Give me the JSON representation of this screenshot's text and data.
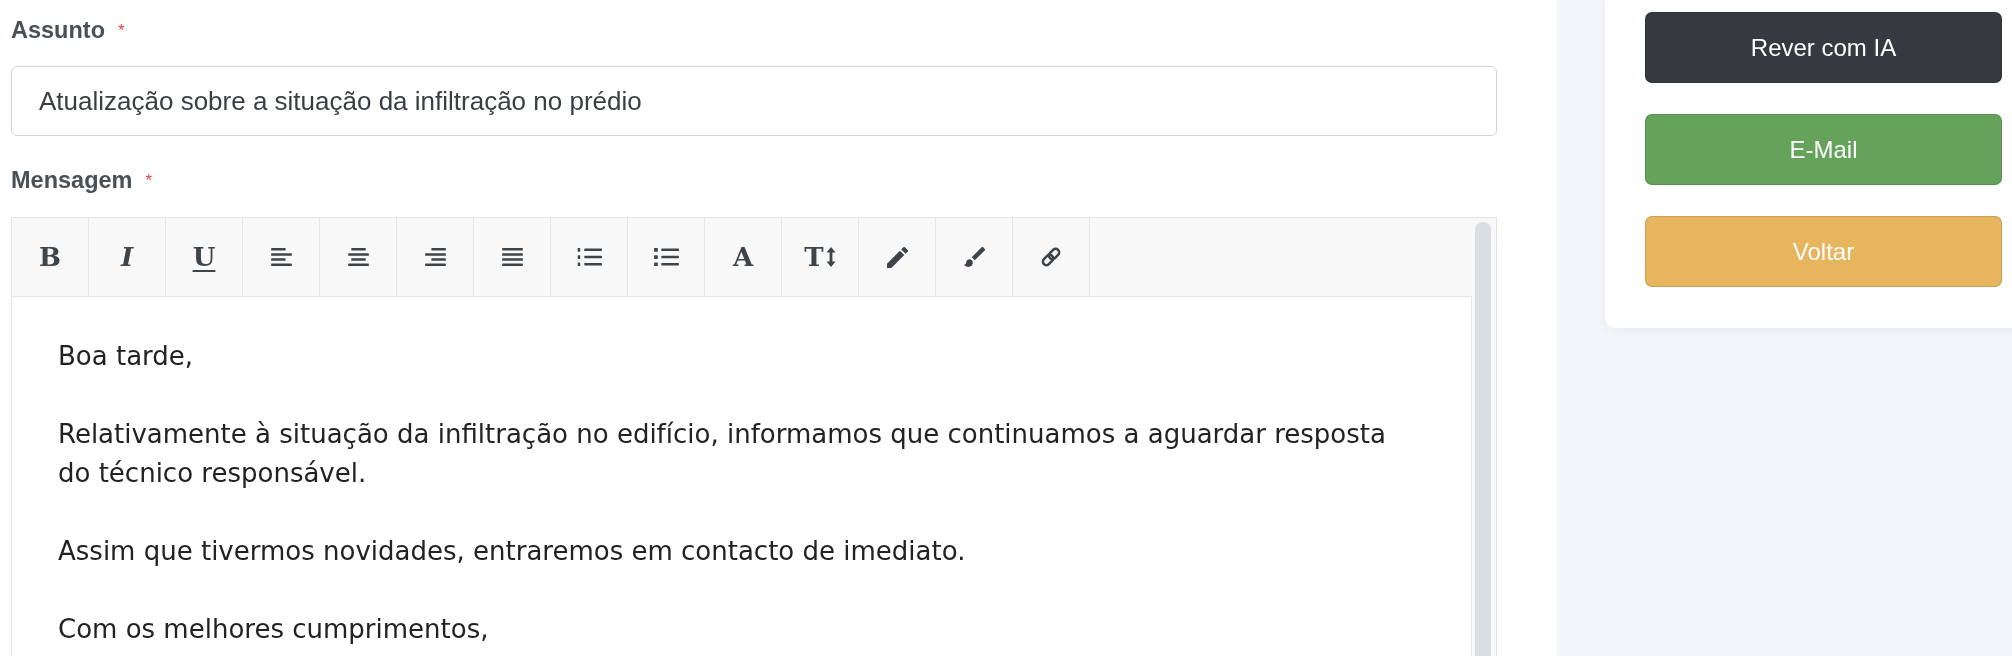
{
  "subject": {
    "label": "Assunto",
    "required_mark": "*",
    "value": "Atualização sobre a situação da infiltração no prédio"
  },
  "message": {
    "label": "Mensagem",
    "required_mark": "*",
    "toolbar": [
      {
        "kind": "bold",
        "glyph": "B"
      },
      {
        "kind": "italic",
        "glyph": "I"
      },
      {
        "kind": "underline",
        "glyph": "U"
      },
      {
        "kind": "align-left"
      },
      {
        "kind": "align-center"
      },
      {
        "kind": "align-right"
      },
      {
        "kind": "justify"
      },
      {
        "kind": "ordered-list"
      },
      {
        "kind": "bullet-list"
      },
      {
        "kind": "font",
        "glyph": "A"
      },
      {
        "kind": "font-size",
        "glyph": "T"
      },
      {
        "kind": "pencil"
      },
      {
        "kind": "brush"
      },
      {
        "kind": "link"
      }
    ],
    "paragraphs": [
      "Boa tarde,",
      "Relativamente à situação da infiltração no edifício, informamos que continuamos a aguardar resposta do técnico responsável.",
      "Assim que tivermos novidades, entraremos em contacto de imediato.",
      "Com os melhores cumprimentos,"
    ]
  },
  "actions": [
    {
      "label": "Rever com IA",
      "color": "#353a41"
    },
    {
      "label": "E-Mail",
      "color": "#65a25a"
    },
    {
      "label": "Voltar",
      "color": "#e8b55f"
    }
  ]
}
